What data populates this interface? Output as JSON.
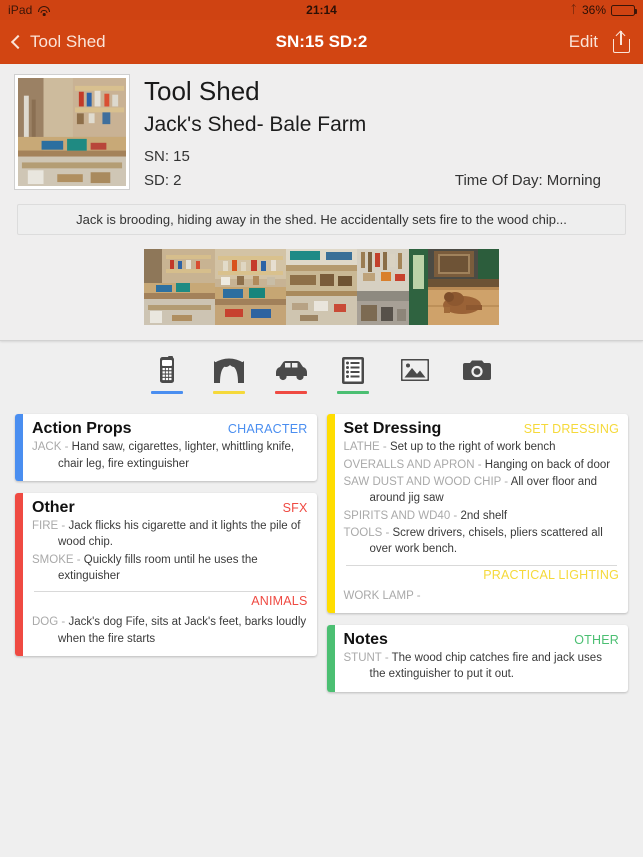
{
  "status_bar": {
    "device": "iPad",
    "wifi_icon": "wifi-icon",
    "time": "21:14",
    "bluetooth_icon": "bluetooth-icon",
    "battery_percent": "36%",
    "battery_level": 36
  },
  "nav_bar": {
    "back_label": "Tool Shed",
    "back_icon": "chevron-left-icon",
    "title": "SN:15 SD:2",
    "edit_label": "Edit",
    "share_icon": "share-icon",
    "background_color": "#d24512"
  },
  "scene": {
    "title": "Tool Shed",
    "location": "Jack's Shed- Bale Farm",
    "scene_number": "SN: 15",
    "script_day": "SD: 2",
    "time_of_day": "Time Of Day: Morning",
    "description": "Jack is brooding, hiding away in the shed. He accidentally sets fire to the wood chip...",
    "thumbnail_count": 5,
    "thumbnails": [
      "shed-workbench-photo",
      "shed-shelves-photo",
      "shed-tools-bench-photo",
      "shed-hanging-tools-photo",
      "dog-on-floor-photo"
    ]
  },
  "tabs": [
    {
      "id": "cast",
      "icon": "mobile-phone-icon",
      "underline_color": "#4a8ef0"
    },
    {
      "id": "set",
      "icon": "stage-curtain-icon",
      "underline_color": "#f5d93a"
    },
    {
      "id": "vehicles",
      "icon": "car-icon",
      "underline_color": "#ef4a42"
    },
    {
      "id": "breakdown",
      "icon": "clipboard-list-icon",
      "underline_color": "#4bbf72"
    },
    {
      "id": "gallery",
      "icon": "picture-icon",
      "underline_color": ""
    },
    {
      "id": "camera",
      "icon": "camera-icon",
      "underline_color": ""
    }
  ],
  "cards": {
    "left": [
      {
        "title": "Action Props",
        "bar_color": "#4a8ef0",
        "tag": "CHARACTER",
        "tag_color": "#4a8ef0",
        "entries": [
          {
            "label": "JACK",
            "text": "Hand saw, cigarettes, lighter, whittling knife, chair leg, fire extinguisher"
          }
        ],
        "sections": []
      },
      {
        "title": "Other",
        "bar_color": "#ef4a42",
        "tag": "SFX",
        "tag_color": "#ef4a42",
        "entries": [
          {
            "label": "FIRE",
            "text": "Jack flicks his cigarette and it lights the pile of wood chip."
          },
          {
            "label": "SMOKE",
            "text": "Quickly fills room until he uses the extinguisher"
          }
        ],
        "sections": [
          {
            "tag": "ANIMALS",
            "tag_color": "#ef4a42",
            "entries": [
              {
                "label": "DOG",
                "text": "Jack's dog Fife, sits at Jack's feet, barks loudly when the fire starts"
              }
            ]
          }
        ]
      }
    ],
    "right": [
      {
        "title": "Set Dressing",
        "bar_color": "#ffdd00",
        "tag": "SET DRESSING",
        "tag_color": "#f5d93a",
        "entries": [
          {
            "label": "LATHE",
            "text": "Set up to the right of work bench"
          },
          {
            "label": "OVERALLS AND APRON",
            "text": "Hanging on back of door"
          },
          {
            "label": "SAW DUST AND WOOD CHIP",
            "text": "All over floor and around jig saw"
          },
          {
            "label": "SPIRITS AND WD40",
            "text": "2nd shelf"
          },
          {
            "label": "TOOLS",
            "text": "Screw drivers, chisels, pliers scattered all over work bench."
          }
        ],
        "sections": [
          {
            "tag": "PRACTICAL LIGHTING",
            "tag_color": "#f5d93a",
            "entries": [
              {
                "label": "WORK LAMP",
                "text": ""
              }
            ]
          }
        ]
      },
      {
        "title": "Notes",
        "bar_color": "#4bbf72",
        "tag": "OTHER",
        "tag_color": "#4bbf72",
        "entries": [
          {
            "label": "STUNT",
            "text": "The wood chip catches fire and jack uses the extinguisher to put it out."
          }
        ],
        "sections": []
      }
    ]
  }
}
